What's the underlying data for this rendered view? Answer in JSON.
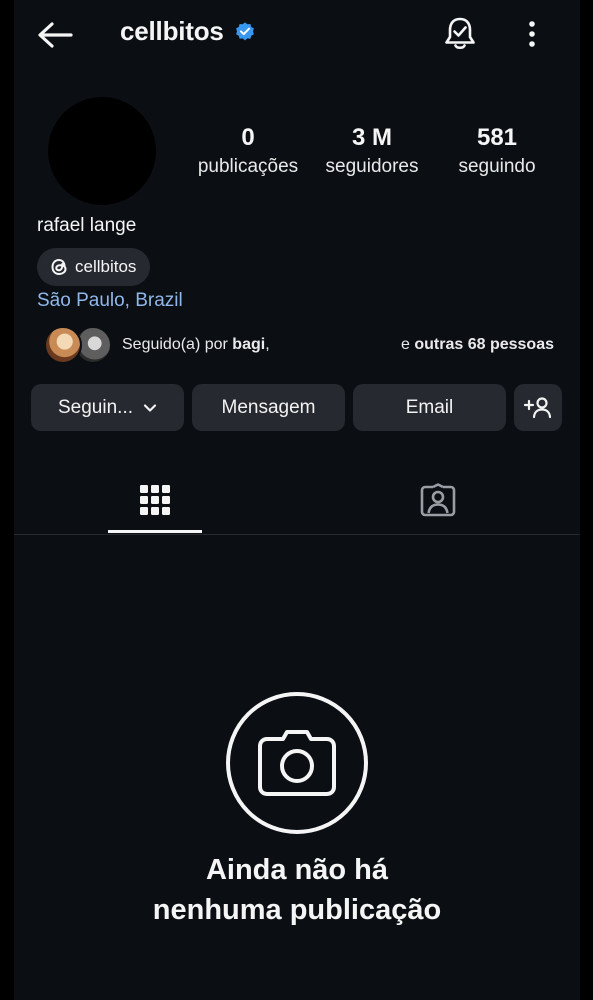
{
  "header": {
    "username": "cellbitos",
    "back_icon": "arrow-left-icon",
    "verified_icon": "verified-badge-icon",
    "bell_icon": "bell-check-icon",
    "more_icon": "more-vertical-icon",
    "verified_color": "#3897f0"
  },
  "profile": {
    "stats": [
      {
        "value": "0",
        "label": "publicações"
      },
      {
        "value": "3 M",
        "label": "seguidores"
      },
      {
        "value": "581",
        "label": "seguindo"
      }
    ],
    "full_name": "rafael lange",
    "threads_handle": "cellbitos",
    "location": "São Paulo, Brazil",
    "followed_by": {
      "prefix": "Seguido(a) por ",
      "name": "bagi",
      "separator": ",",
      "others_prefix": "e ",
      "others_bold": "outras 68 pessoas"
    }
  },
  "actions": {
    "following_label": "Seguin...",
    "message_label": "Mensagem",
    "email_label": "Email",
    "add_icon": "add-person-icon"
  },
  "tabs": {
    "grid_icon": "grid-icon",
    "tagged_icon": "tagged-person-icon"
  },
  "empty_state": {
    "icon": "camera-icon",
    "line1": "Ainda não há",
    "line2": "nenhuma publicação"
  },
  "colors": {
    "background": "#0b0f14",
    "button": "#262a30",
    "location_link": "#8fb7ea"
  }
}
